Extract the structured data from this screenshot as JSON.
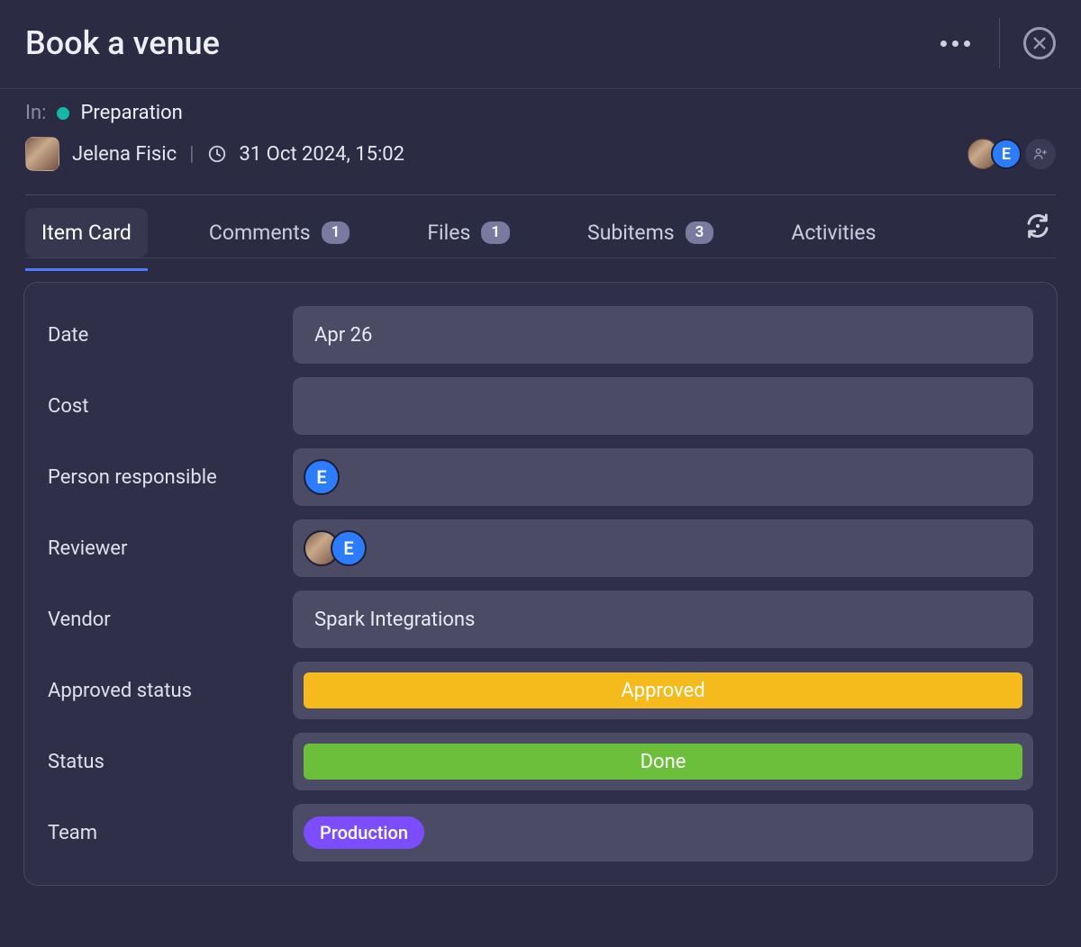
{
  "header": {
    "title": "Book a venue"
  },
  "meta": {
    "in_label": "In:",
    "section_name": "Preparation",
    "section_color": "#14b8a6",
    "author_name": "Jelena Fisic",
    "timestamp": "31 Oct 2024, 15:02",
    "watcher_letter": "E"
  },
  "tabs": {
    "item_card": "Item  Card",
    "comments": {
      "label": "Comments",
      "count": "1"
    },
    "files": {
      "label": "Files",
      "count": "1"
    },
    "subitems": {
      "label": "Subitems",
      "count": "3"
    },
    "activities": "Activities"
  },
  "fields": {
    "date": {
      "label": "Date",
      "value": "Apr 26"
    },
    "cost": {
      "label": "Cost",
      "value": ""
    },
    "person_responsible": {
      "label": "Person responsible",
      "avatar_letter": "E"
    },
    "reviewer": {
      "label": "Reviewer",
      "avatar_letter": "E"
    },
    "vendor": {
      "label": "Vendor",
      "value": "Spark Integrations"
    },
    "approved_status": {
      "label": "Approved status",
      "value": "Approved",
      "color": "#f5bb1d"
    },
    "status": {
      "label": "Status",
      "value": "Done",
      "color": "#6bbf3b"
    },
    "team": {
      "label": "Team",
      "value": "Production",
      "color": "#7c4dff"
    }
  }
}
